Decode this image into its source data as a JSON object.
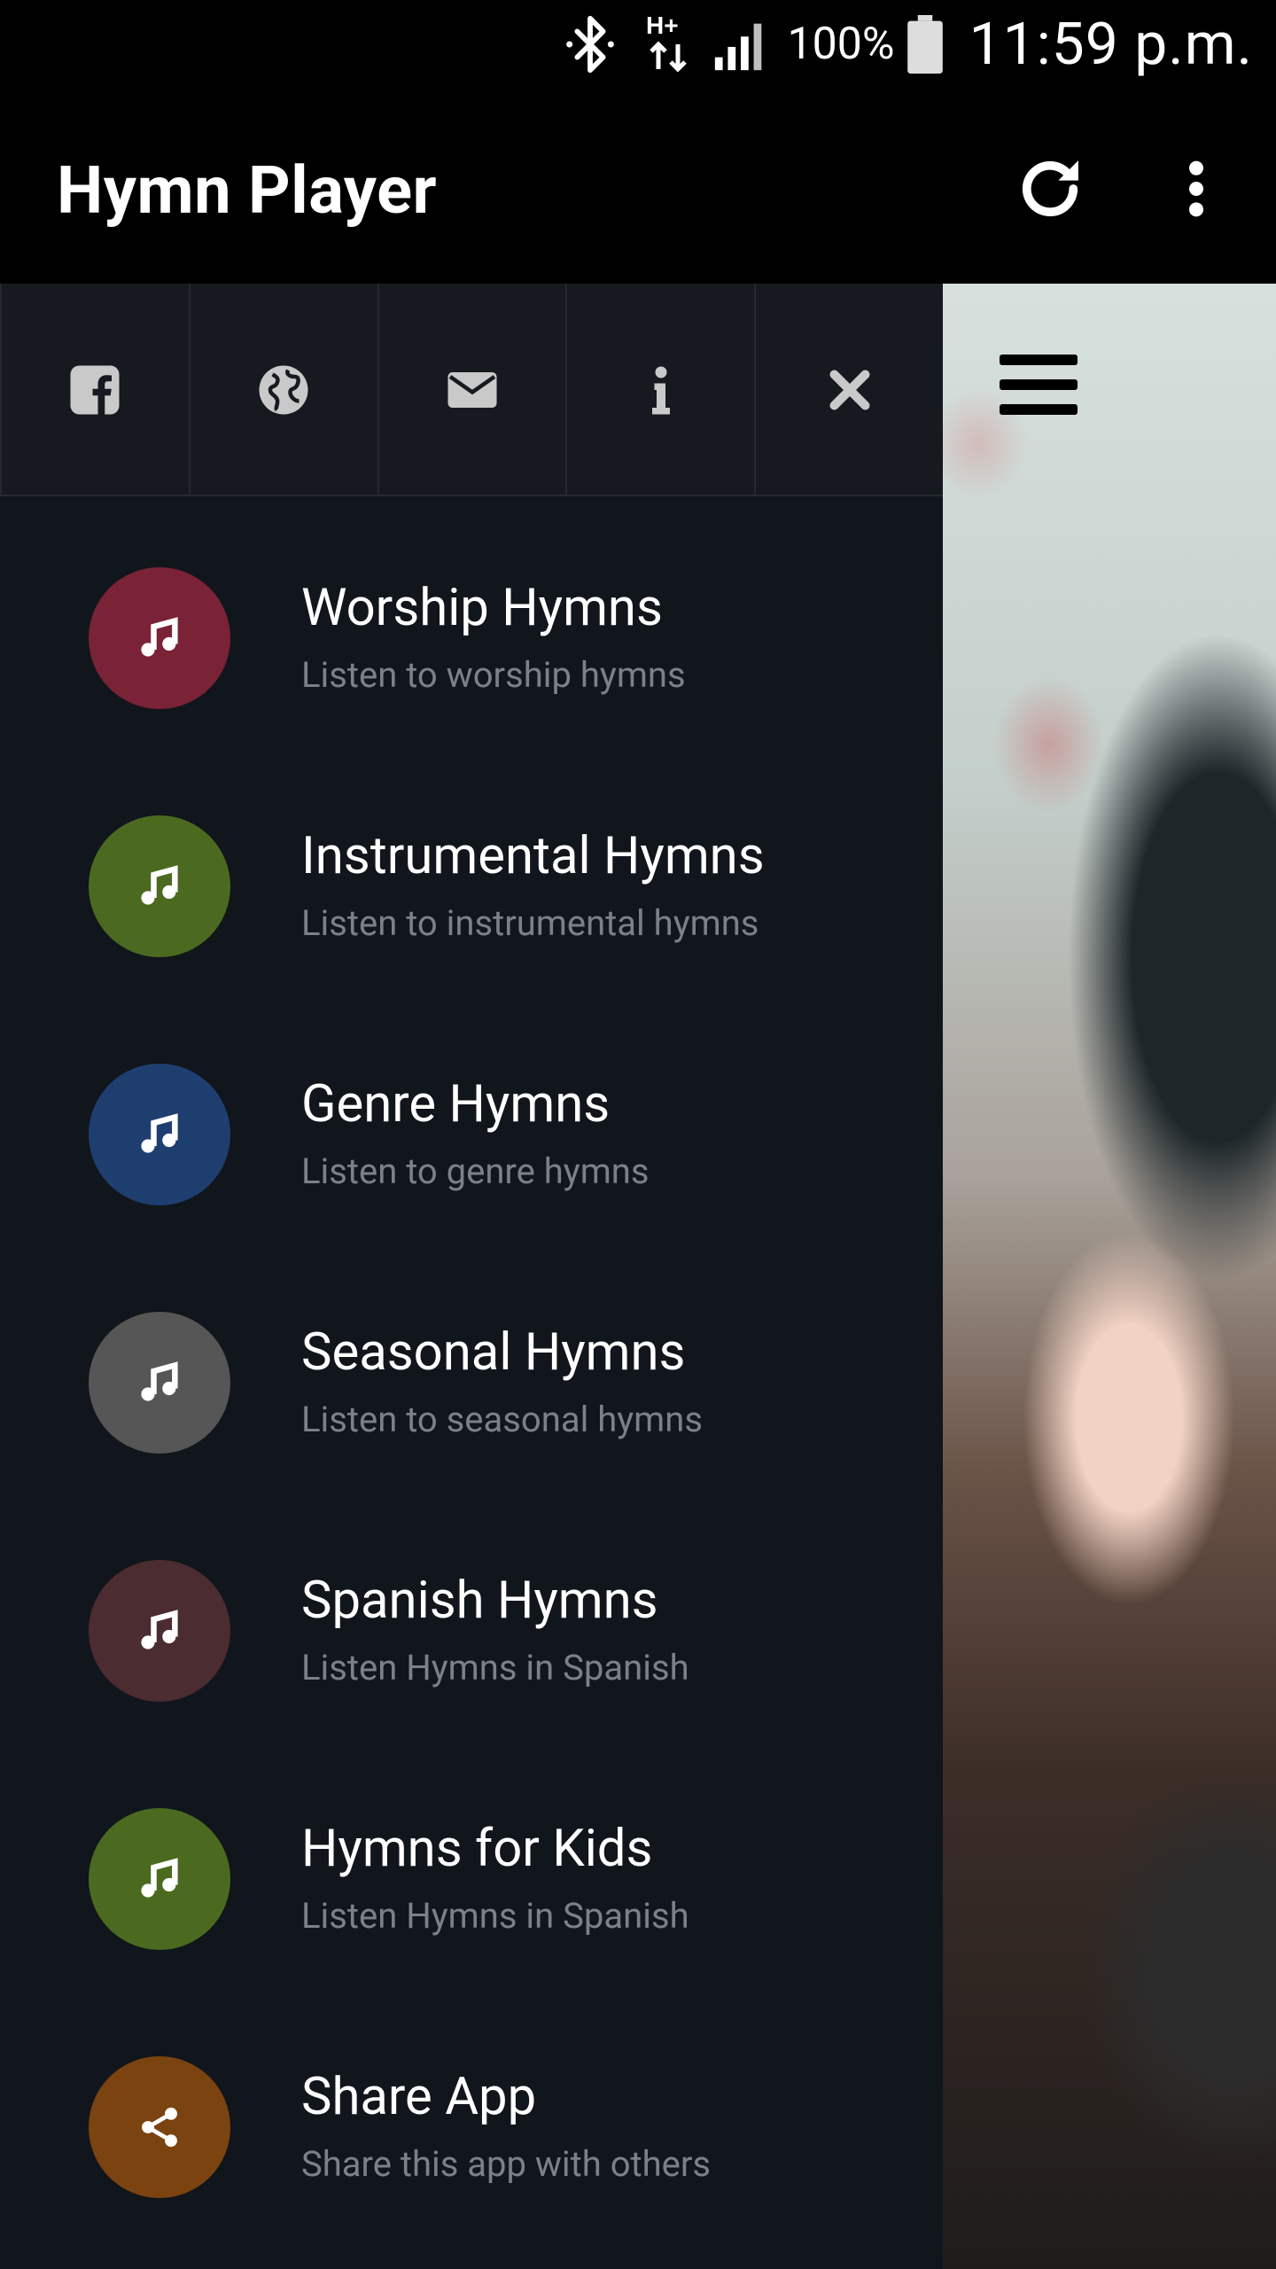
{
  "status_bar": {
    "battery_percent": "100%",
    "time": "11:59 p.m.",
    "icons": [
      "bluetooth-icon",
      "network-hplus-icon",
      "signal-icon",
      "battery-icon"
    ]
  },
  "app_bar": {
    "title": "Hymn Player",
    "actions": [
      "refresh-icon",
      "more-vert-icon"
    ]
  },
  "drawer": {
    "toolbar": [
      "facebook-icon",
      "globe-icon",
      "envelope-icon",
      "info-icon",
      "close-icon"
    ],
    "items": [
      {
        "title": "Worship Hymns",
        "subtitle": "Listen to worship hymns",
        "color": "#7a2236",
        "icon": "music-note-icon"
      },
      {
        "title": "Instrumental Hymns",
        "subtitle": "Listen to instrumental hymns",
        "color": "#4b6a1f",
        "icon": "music-note-icon"
      },
      {
        "title": "Genre Hymns",
        "subtitle": "Listen to genre hymns",
        "color": "#1f3e70",
        "icon": "music-note-icon"
      },
      {
        "title": "Seasonal Hymns",
        "subtitle": "Listen to seasonal hymns",
        "color": "#565656",
        "icon": "music-note-icon"
      },
      {
        "title": "Spanish Hymns",
        "subtitle": "Listen Hymns in Spanish",
        "color": "#4b2c30",
        "icon": "music-note-icon"
      },
      {
        "title": "Hymns for Kids",
        "subtitle": "Listen Hymns in Spanish",
        "color": "#4b6a1f",
        "icon": "music-note-icon"
      },
      {
        "title": "Share App",
        "subtitle": "Share this app with others",
        "color": "#7a4310",
        "icon": "share-icon"
      }
    ]
  },
  "content": {
    "menu_icon": "hamburger-menu-icon"
  }
}
